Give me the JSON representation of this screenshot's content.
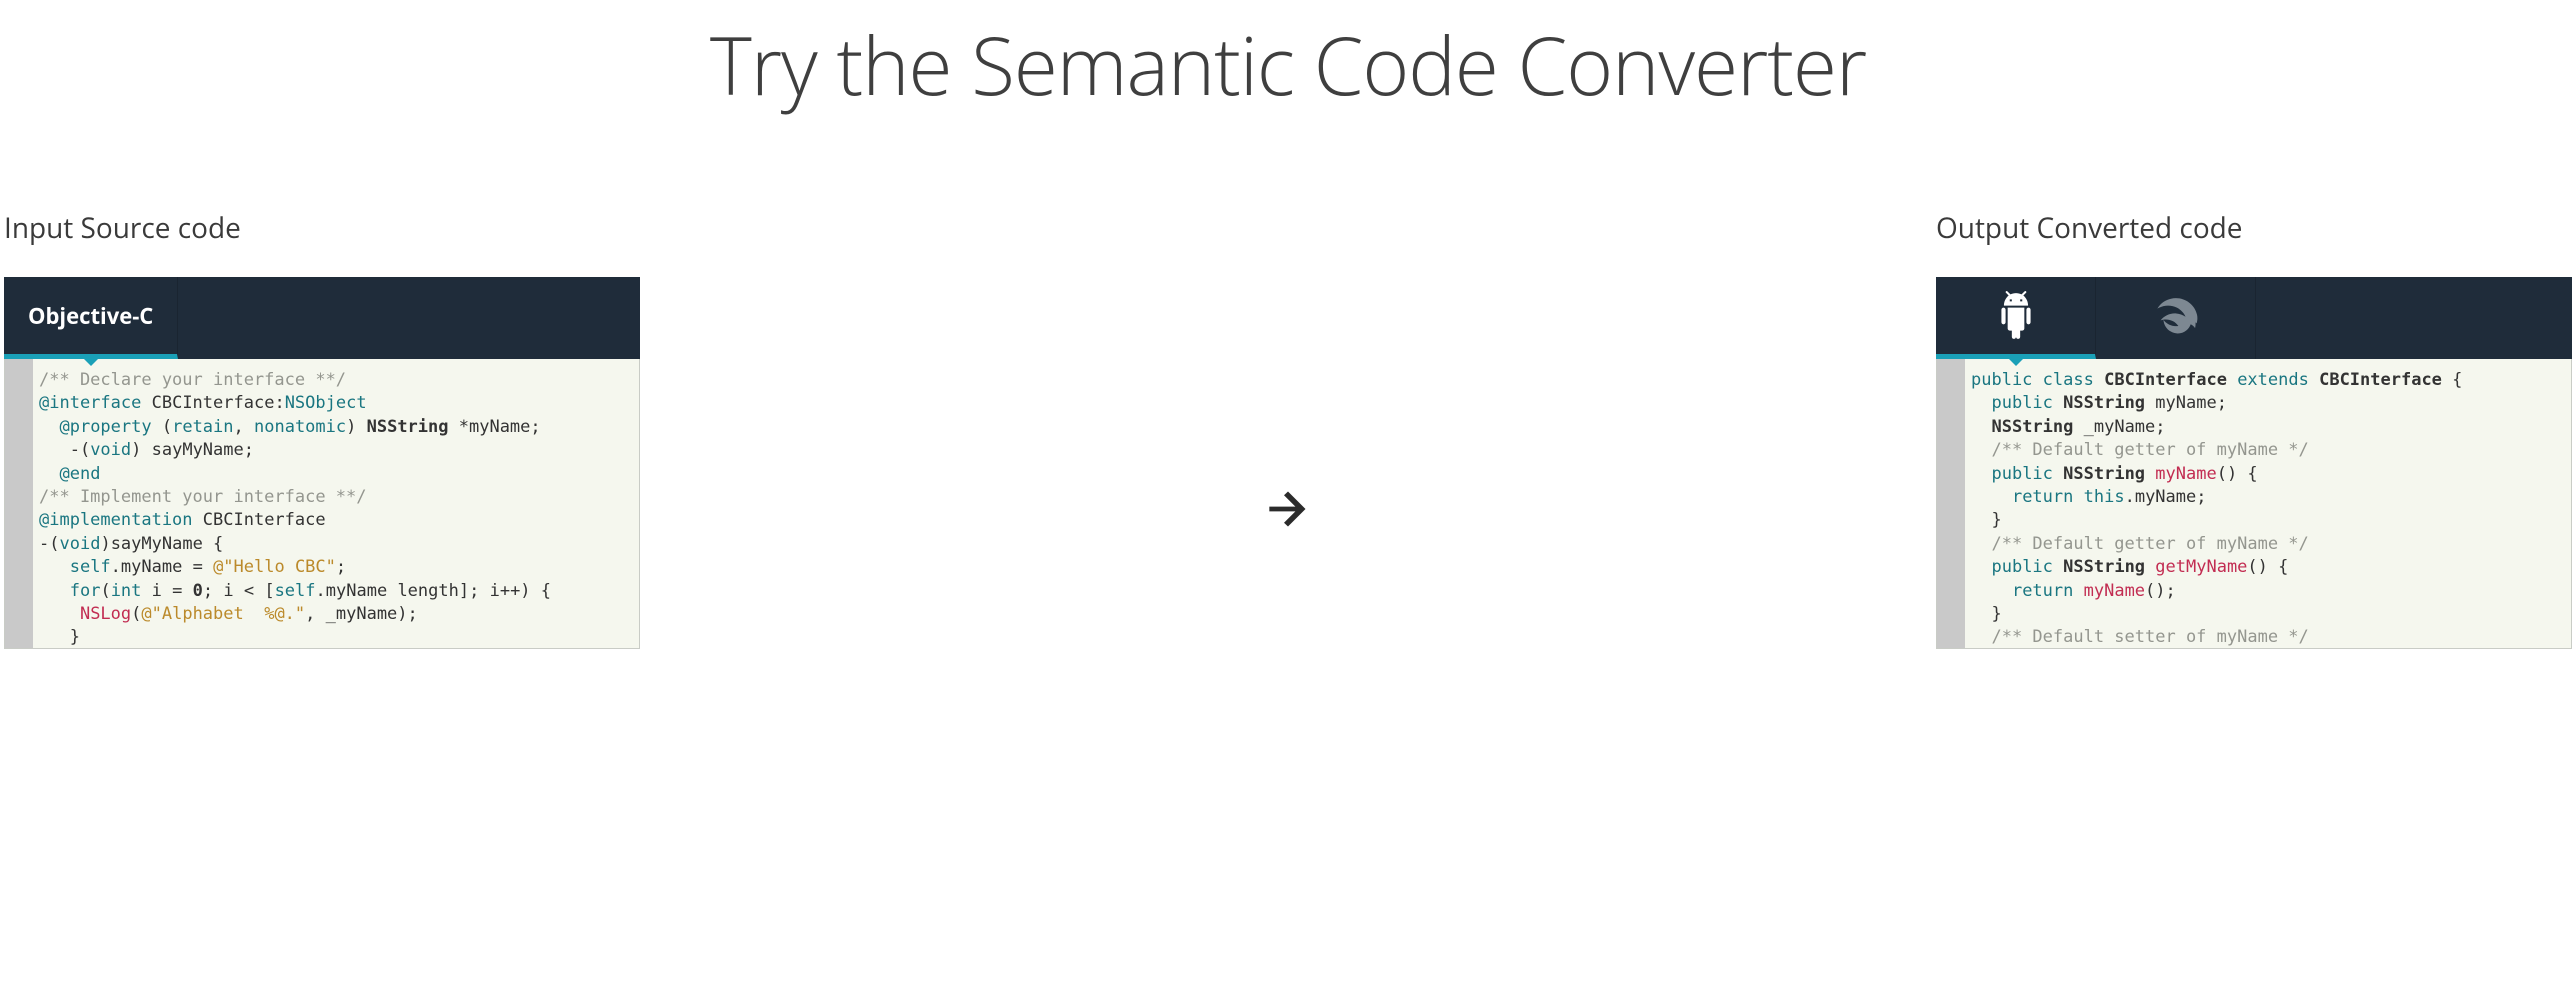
{
  "title": "Try the Semantic Code Converter",
  "input": {
    "label": "Input Source code",
    "tab": "Objective-C",
    "code_html": "<span class=\"c-comment\">/** Declare your interface **/</span>\n<span class=\"c-at\">@interface</span> <span class=\"c-ident\">CBCInterface</span>:<span class=\"c-type\">NSObject</span>\n  <span class=\"c-at\">@property</span> (<span class=\"c-kw2\">retain</span>, <span class=\"c-kw2\">nonatomic</span>) <span class=\"c-ident c-bold\">NSString</span> *<span class=\"c-ident\">myName</span>;\n   -(<span class=\"c-type\">void</span>) <span class=\"c-ident\">sayMyName</span>;\n  <span class=\"c-at\">@end</span>\n<span class=\"c-comment\">/** Implement your interface **/</span>\n<span class=\"c-at\">@implementation</span> <span class=\"c-ident\">CBCInterface</span>\n-(<span class=\"c-type\">void</span>)<span class=\"c-ident\">sayMyName</span> {\n   <span class=\"c-kw2\">self</span>.<span class=\"c-ident\">myName</span> = <span class=\"c-string\">@\"Hello CBC\"</span>;\n   <span class=\"c-kw2\">for</span>(<span class=\"c-type\">int</span> <span class=\"c-ident\">i</span> = <span class=\"c-num\">0</span>; <span class=\"c-ident\">i</span> &lt; [<span class=\"c-kw2\">self</span>.<span class=\"c-ident\">myName</span> <span class=\"c-ident\">length</span>]; <span class=\"c-ident\">i</span>++) {\n    <span class=\"c-func\">NSLog</span>(<span class=\"c-string\">@\"Alphabet  %@.\"</span>, <span class=\"c-ident\">_myName</span>);\n   }"
  },
  "output": {
    "label": "Output Converted code",
    "tabs": [
      "android",
      "swift"
    ],
    "active_tab": "android",
    "code_html": "<span class=\"c-pub\">public</span> <span class=\"c-kw2\">class</span> <span class=\"c-ident c-bold\">CBCInterface</span> <span class=\"c-kw2\">extends</span> <span class=\"c-ident c-bold\">CBCInterface</span> {\n  <span class=\"c-pub\">public</span> <span class=\"c-ident c-bold\">NSString</span> <span class=\"c-ident\">myName</span>;\n  <span class=\"c-ident c-bold\">NSString</span> <span class=\"c-ident\">_myName</span>;\n  <span class=\"c-comment\">/** Default getter of myName */</span>\n  <span class=\"c-pub\">public</span> <span class=\"c-ident c-bold\">NSString</span> <span class=\"c-func\">myName</span>() {\n    <span class=\"c-kw2\">return</span> <span class=\"c-kw2\">this</span>.<span class=\"c-ident\">myName</span>;\n  }\n  <span class=\"c-comment\">/** Default getter of myName */</span>\n  <span class=\"c-pub\">public</span> <span class=\"c-ident c-bold\">NSString</span> <span class=\"c-func\">getMyName</span>() {\n    <span class=\"c-kw2\">return</span> <span class=\"c-func\">myName</span>();\n  }\n  <span class=\"c-comment\">/** Default setter of myName */</span>\n  <span class=\"c-pub\">public</span> <span class=\"c-type\">void</span> <span class=\"c-func\">setMyName</span>(<span class=\"c-ident c-bold\">NSString</span> <span class=\"c-ident\">myName</span>) {"
  },
  "colors": {
    "tabbar_bg": "#1f2c3a",
    "accent": "#1aa0b7",
    "code_bg": "#f5f7ee",
    "gutter": "#c9c9c9"
  }
}
